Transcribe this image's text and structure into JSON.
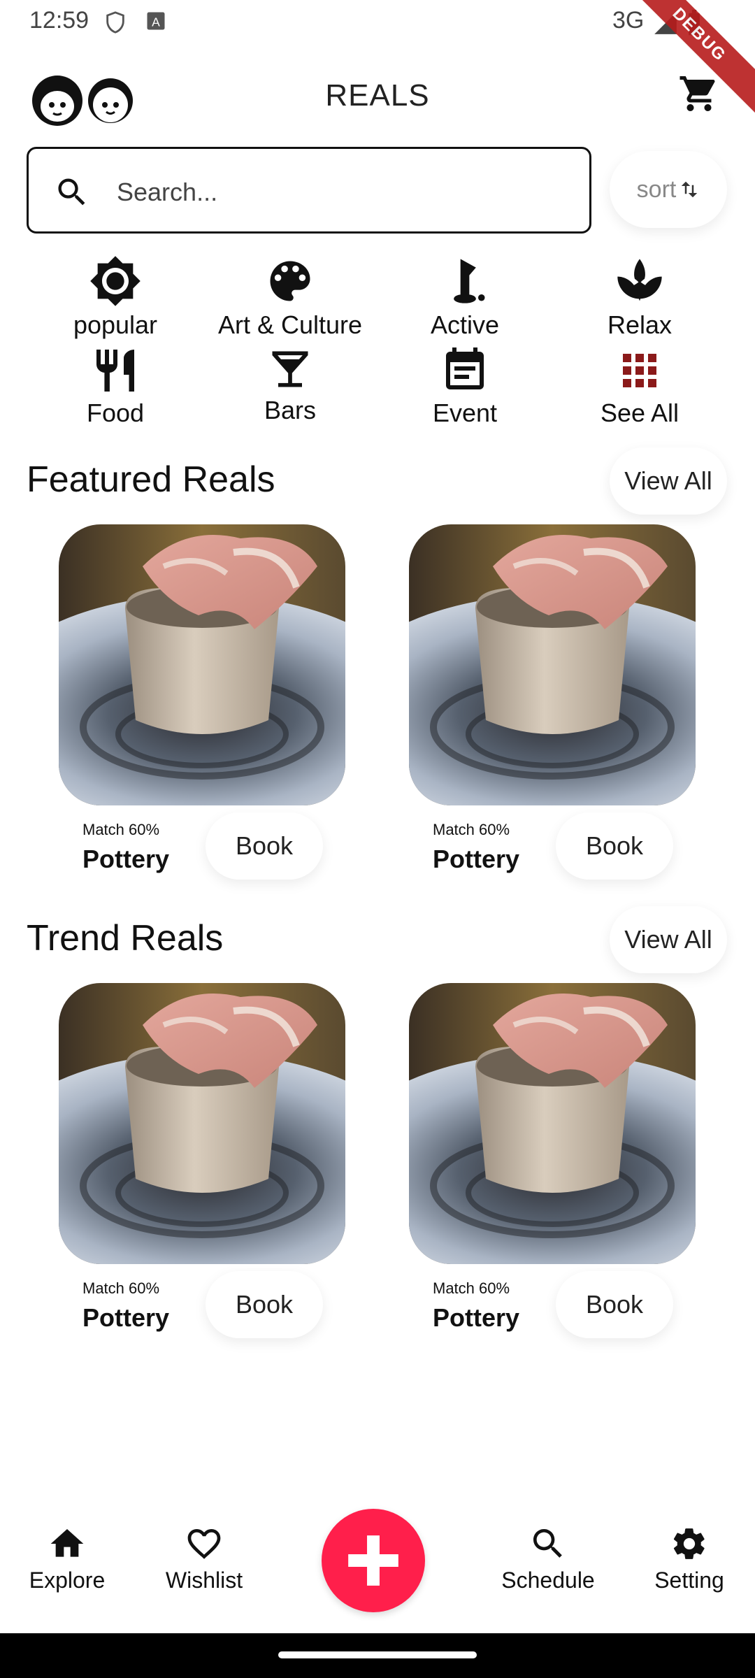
{
  "status": {
    "time": "12:59",
    "network": "3G",
    "debug_label": "DEBUG"
  },
  "app": {
    "title": "REALS"
  },
  "search": {
    "placeholder": "Search...",
    "sort_label": "sort"
  },
  "categories": [
    {
      "label": "popular",
      "icon": "sun-icon"
    },
    {
      "label": "Art & Culture",
      "icon": "palette-icon"
    },
    {
      "label": "Active",
      "icon": "golf-icon"
    },
    {
      "label": "Relax",
      "icon": "spa-icon"
    },
    {
      "label": "Food",
      "icon": "restaurant-icon"
    },
    {
      "label": "Bars",
      "icon": "cocktail-icon"
    },
    {
      "label": "Event",
      "icon": "calendar-icon"
    },
    {
      "label": "See All",
      "icon": "grid-icon"
    }
  ],
  "sections": [
    {
      "title": "Featured Reals",
      "view_all": "View All",
      "cards": [
        {
          "match": "Match 60%",
          "title": "Pottery",
          "book": "Book"
        },
        {
          "match": "Match 60%",
          "title": "Pottery",
          "book": "Book"
        }
      ]
    },
    {
      "title": "Trend Reals",
      "view_all": "View All",
      "cards": [
        {
          "match": "Match 60%",
          "title": "Pottery",
          "book": "Book"
        },
        {
          "match": "Match 60%",
          "title": "Pottery",
          "book": "Book"
        }
      ]
    }
  ],
  "nav": [
    {
      "label": "Explore",
      "icon": "home-icon"
    },
    {
      "label": "Wishlist",
      "icon": "heart-icon"
    },
    {
      "label": "Schedule",
      "icon": "search-icon"
    },
    {
      "label": "Setting",
      "icon": "gear-icon"
    }
  ],
  "colors": {
    "accent": "#ff1f4b",
    "see_all_icon": "#8b1a1a"
  }
}
